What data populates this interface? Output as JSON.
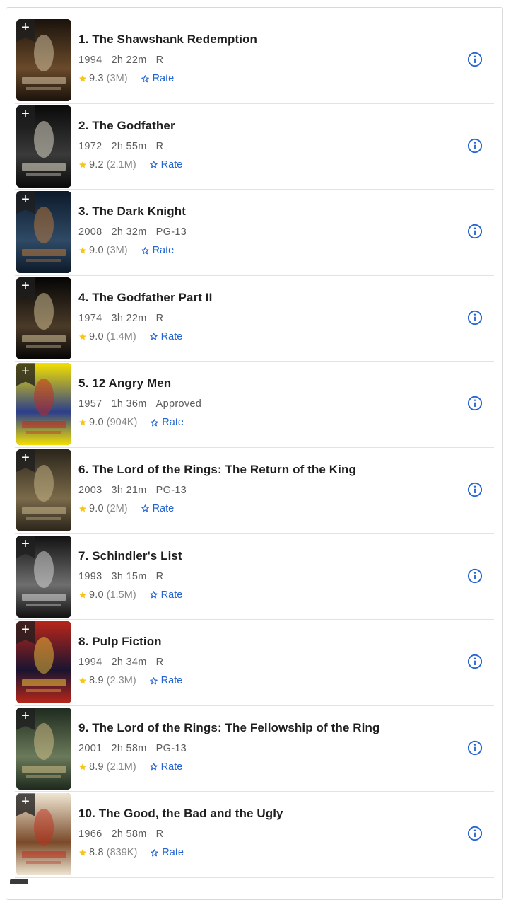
{
  "colors": {
    "accent_blue": "#2364d2",
    "star_gold": "#f5c518",
    "title_text": "#1f1f1f",
    "meta_text": "#5c5c5c"
  },
  "movies": [
    {
      "title": "1. The Shawshank Redemption",
      "year": "1994",
      "runtime": "2h 22m",
      "certificate": "R",
      "rating": "9.3",
      "votes": "(3M)",
      "rate_label": "Rate",
      "poster_palette": [
        "#1a120c",
        "#6a4a2a",
        "#d8c9a8"
      ]
    },
    {
      "title": "2. The Godfather",
      "year": "1972",
      "runtime": "2h 55m",
      "certificate": "R",
      "rating": "9.2",
      "votes": "(2.1M)",
      "rate_label": "Rate",
      "poster_palette": [
        "#0a0a0a",
        "#3a3a3a",
        "#e8e2d0"
      ]
    },
    {
      "title": "3. The Dark Knight",
      "year": "2008",
      "runtime": "2h 32m",
      "certificate": "PG-13",
      "rating": "9.0",
      "votes": "(3M)",
      "rate_label": "Rate",
      "poster_palette": [
        "#0d1a2a",
        "#2f4a66",
        "#c07a3a"
      ]
    },
    {
      "title": "4. The Godfather Part II",
      "year": "1974",
      "runtime": "3h 22m",
      "certificate": "R",
      "rating": "9.0",
      "votes": "(1.4M)",
      "rate_label": "Rate",
      "poster_palette": [
        "#050505",
        "#4a3a28",
        "#d9c79a"
      ]
    },
    {
      "title": "5. 12 Angry Men",
      "year": "1957",
      "runtime": "1h 36m",
      "certificate": "Approved",
      "rating": "9.0",
      "votes": "(904K)",
      "rate_label": "Rate",
      "poster_palette": [
        "#f4e000",
        "#2a3e8c",
        "#c8281e"
      ]
    },
    {
      "title": "6. The Lord of the Rings: The Return of the King",
      "year": "2003",
      "runtime": "3h 21m",
      "certificate": "PG-13",
      "rating": "9.0",
      "votes": "(2M)",
      "rate_label": "Rate",
      "poster_palette": [
        "#2a241a",
        "#7a6a4a",
        "#cbb98a"
      ]
    },
    {
      "title": "7. Schindler's List",
      "year": "1993",
      "runtime": "3h 15m",
      "certificate": "R",
      "rating": "9.0",
      "votes": "(1.5M)",
      "rate_label": "Rate",
      "poster_palette": [
        "#111111",
        "#6e6e6e",
        "#dcdcdc"
      ]
    },
    {
      "title": "8. Pulp Fiction",
      "year": "1994",
      "runtime": "2h 34m",
      "certificate": "R",
      "rating": "8.9",
      "votes": "(2.3M)",
      "rate_label": "Rate",
      "poster_palette": [
        "#b8261a",
        "#1a1430",
        "#f2c43a"
      ]
    },
    {
      "title": "9. The Lord of the Rings: The Fellowship of the Ring",
      "year": "2001",
      "runtime": "2h 58m",
      "certificate": "PG-13",
      "rating": "8.9",
      "votes": "(2.1M)",
      "rate_label": "Rate",
      "poster_palette": [
        "#1e2a1e",
        "#6a7a5a",
        "#d6c28a"
      ]
    },
    {
      "title": "10. The Good, the Bad and the Ugly",
      "year": "1966",
      "runtime": "2h 58m",
      "certificate": "R",
      "rating": "8.8",
      "votes": "(839K)",
      "rate_label": "Rate",
      "poster_palette": [
        "#efe6d2",
        "#7a4a2a",
        "#c0301e"
      ]
    }
  ]
}
